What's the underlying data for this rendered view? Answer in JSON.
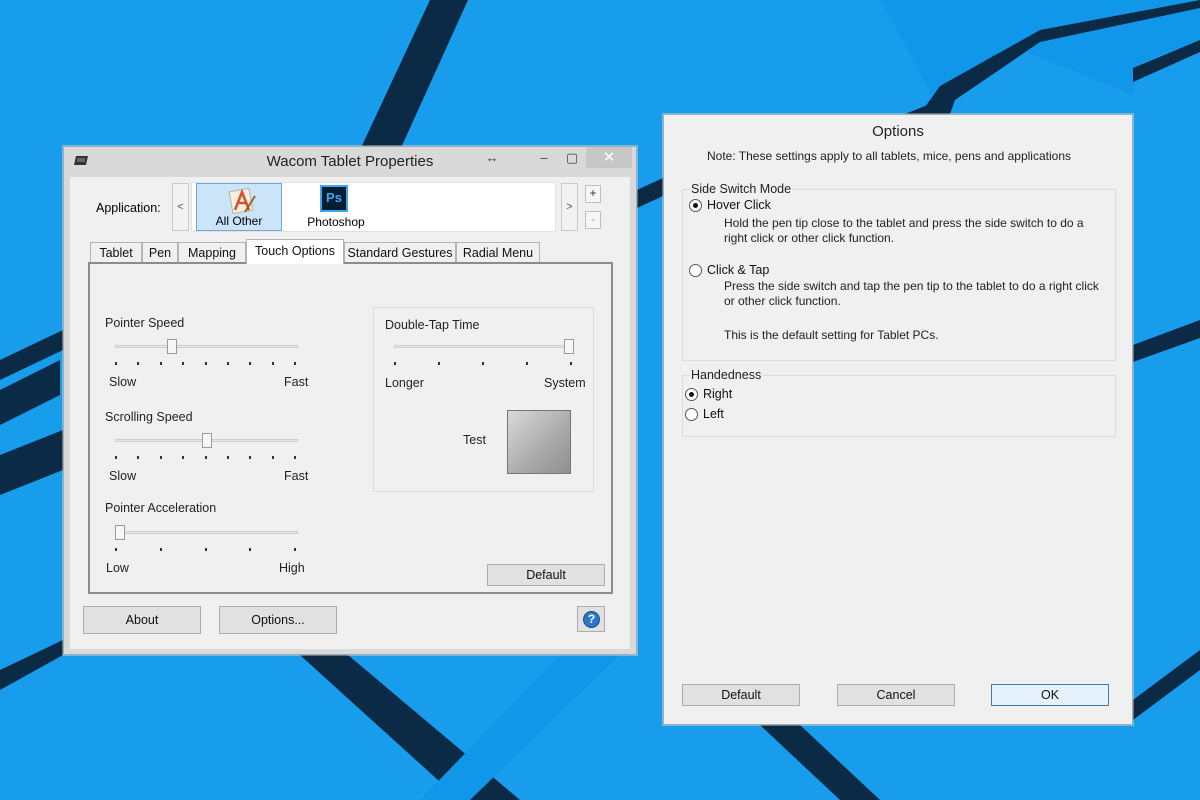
{
  "wacom": {
    "title": "Wacom Tablet Properties",
    "application_label": "Application:",
    "prev_arrow": "<",
    "next_arrow": ">",
    "add_button": "+",
    "remove_button": "-",
    "apps": [
      {
        "label": "All Other",
        "icon": "all-other-app-icon",
        "selected": true
      },
      {
        "label": "Photoshop",
        "icon": "photoshop-app-icon",
        "icon_text": "Ps",
        "selected": false
      }
    ],
    "tabs": [
      {
        "label": "Tablet",
        "active": false
      },
      {
        "label": "Pen",
        "active": false
      },
      {
        "label": "Mapping",
        "active": false
      },
      {
        "label": "Touch Options",
        "active": true
      },
      {
        "label": "Standard Gestures",
        "active": false
      },
      {
        "label": "Radial Menu",
        "active": false
      }
    ],
    "touch_options": {
      "pointer_speed": {
        "label": "Pointer Speed",
        "min_label": "Slow",
        "max_label": "Fast",
        "ticks": 9,
        "level": 0.3
      },
      "scrolling_speed": {
        "label": "Scrolling Speed",
        "min_label": "Slow",
        "max_label": "Fast",
        "ticks": 9,
        "level": 0.5
      },
      "pointer_acceleration": {
        "label": "Pointer Acceleration",
        "min_label": "Low",
        "max_label": "High",
        "ticks": 5,
        "level": 0.0
      },
      "double_tap_time": {
        "label": "Double-Tap Time",
        "min_label": "Longer",
        "max_label": "System",
        "ticks": 5,
        "level": 1.0
      },
      "test_label": "Test",
      "default_button": "Default"
    },
    "about_button": "About",
    "options_button": "Options...",
    "help_button": "?"
  },
  "options": {
    "title": "Options",
    "note": "Note: These settings apply to all tablets, mice, pens and applications",
    "side_switch": {
      "legend": "Side Switch Mode",
      "hover_click": {
        "label": "Hover Click",
        "selected": true,
        "desc_line1": "Hold the pen tip close to the tablet and press the side switch to do a",
        "desc_line2": "right click or other click function."
      },
      "click_tap": {
        "label": "Click & Tap",
        "selected": false,
        "desc_line1": "Press the side switch and tap the pen tip to the tablet to do a right click",
        "desc_line2": "or other click function.",
        "desc_line3": "This is the default setting for Tablet PCs."
      }
    },
    "handedness": {
      "legend": "Handedness",
      "right": {
        "label": "Right",
        "selected": true
      },
      "left": {
        "label": "Left",
        "selected": false
      }
    },
    "default_button": "Default",
    "cancel_button": "Cancel",
    "ok_button": "OK"
  }
}
